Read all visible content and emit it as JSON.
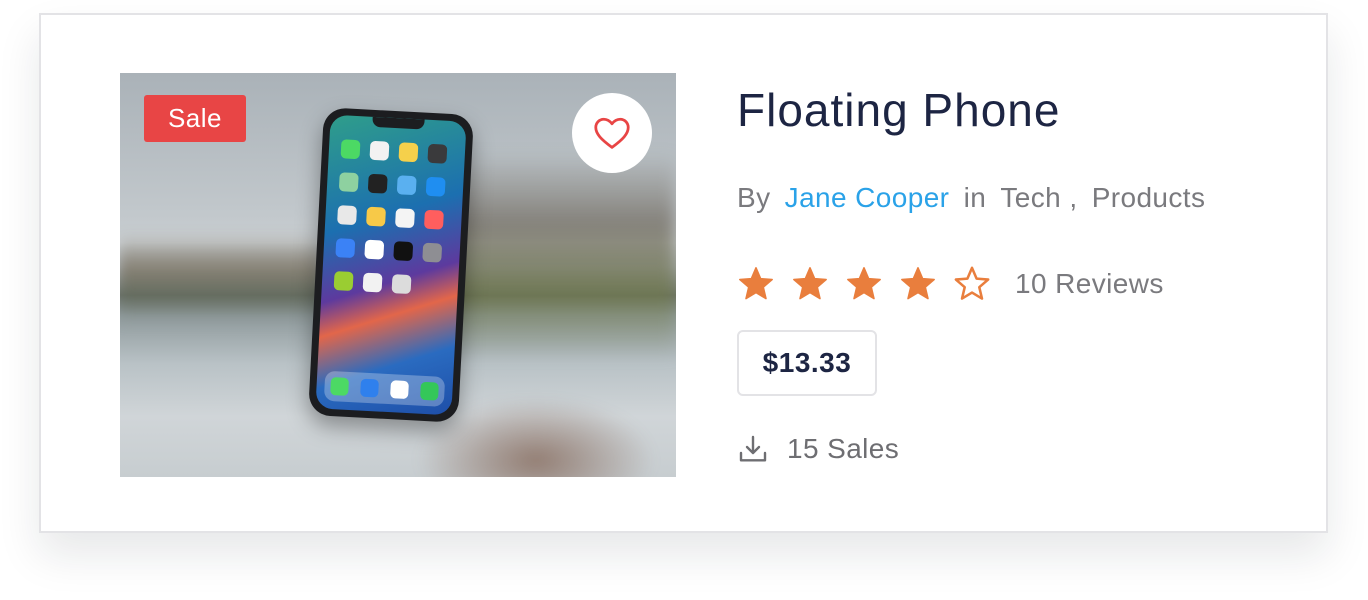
{
  "product": {
    "badge": "Sale",
    "title": "Floating Phone",
    "by_label": "By",
    "author": "Jane Cooper",
    "in_label": "in",
    "categories": [
      "Tech",
      "Products"
    ],
    "category_separator": ",",
    "rating": {
      "value": 4,
      "max": 5
    },
    "reviews": "10 Reviews",
    "price": "$13.33",
    "sales": "15 Sales",
    "image_icon": "phone-photo",
    "wishlist_icon": "heart-icon",
    "sales_icon": "download-icon"
  },
  "colors": {
    "sale_badge": "#e84545",
    "author_link": "#2aa2e8",
    "star": "#e97e3d",
    "heart": "#e84545",
    "title": "#1d2543"
  }
}
